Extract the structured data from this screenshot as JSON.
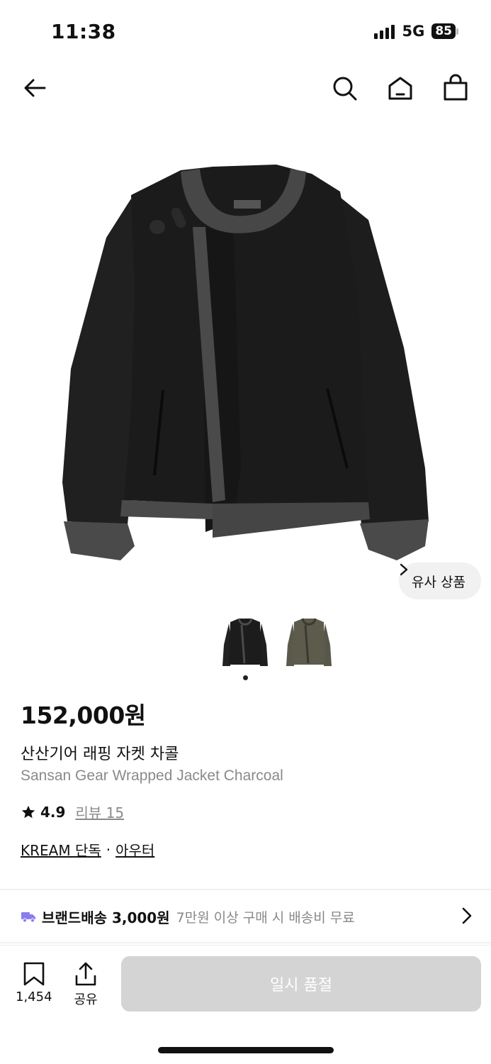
{
  "status_bar": {
    "time": "11:38",
    "network": "5G",
    "battery": "85"
  },
  "nav": {
    "back_icon": "arrow-left-icon",
    "search_icon": "search-icon",
    "home_icon": "home-icon",
    "cart_icon": "shopping-bag-icon"
  },
  "hero": {
    "similar_label": "유사 상품"
  },
  "thumbnails": [
    {
      "color": "charcoal",
      "selected": true
    },
    {
      "color": "olive",
      "selected": false
    }
  ],
  "product": {
    "price": "152,000원",
    "name_ko": "산산기어 래핑 자켓 차콜",
    "name_en": "Sansan Gear Wrapped Jacket Charcoal",
    "rating": "4.9",
    "review_label": "리뷰 15",
    "tag_exclusive": "KREAM 단독",
    "tag_separator": "·",
    "tag_category": "아우터"
  },
  "delivery": {
    "title": "브랜드배송 3,000원",
    "description": "7만원 이상 구매 시 배송비 무료"
  },
  "bottom_bar": {
    "bookmark_count": "1,454",
    "share_label": "공유",
    "buy_label": "일시 품절"
  },
  "colors": {
    "accent_truck": "#8a7cf0",
    "disabled_button": "#d4d4d4"
  }
}
